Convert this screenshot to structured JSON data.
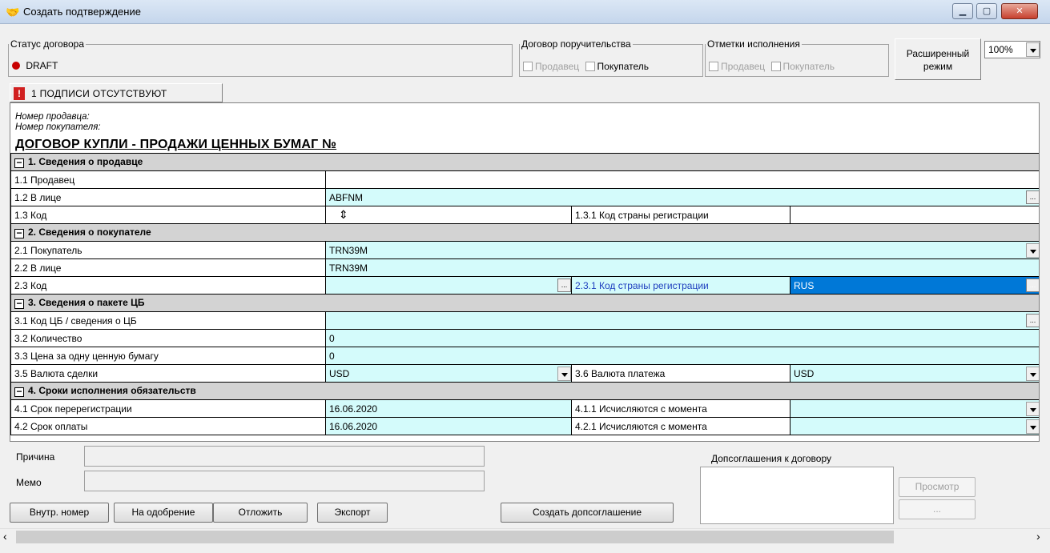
{
  "window": {
    "title": "Создать подтверждение",
    "icon": "handshake-icon"
  },
  "status": {
    "legend": "Статус договора",
    "value": "DRAFT",
    "color": "#c80000"
  },
  "guarantee": {
    "legend": "Договор поручительства",
    "seller": "Продавец",
    "buyer": "Покупатель"
  },
  "execution": {
    "legend": "Отметки исполнения",
    "seller": "Продавец",
    "buyer": "Покупатель"
  },
  "extended_mode": "Расширенный режим",
  "zoom": "100%",
  "signature_tab": "1 ПОДПИСИ ОТСУТСТВУЮТ",
  "doc": {
    "seller_no": "Номер продавца:",
    "buyer_no": "Номер покупателя:",
    "title": "ДОГОВОР КУПЛИ - ПРОДАЖИ ЦЕННЫХ БУМАГ №",
    "s1": "1. Сведения о продавце",
    "r1_1": "1.1 Продавец",
    "r1_2": "1.2 В лице",
    "r1_2v": "ABFNM",
    "r1_3": "1.3 Код",
    "r1_3_1": "1.3.1 Код страны регистрации",
    "s2": "2. Сведения о покупателе",
    "r2_1": "2.1 Покупатель",
    "r2_1v": "TRN39M",
    "r2_2": "2.2 В лице",
    "r2_2v": "TRN39M",
    "r2_3": "2.3 Код",
    "r2_3_1": "2.3.1 Код страны регистрации",
    "r2_3_1v": "RUS",
    "s3": "3. Сведения о пакете ЦБ",
    "r3_1": "3.1 Код ЦБ / сведения о ЦБ",
    "r3_2": "3.2 Количество",
    "r3_2v": "0",
    "r3_3": "3.3 Цена за одну ценную бумагу",
    "r3_3v": "0",
    "r3_5": "3.5 Валюта сделки",
    "r3_5v": "USD",
    "r3_6": "3.6 Валюта платежа",
    "r3_6v": "USD",
    "s4": "4. Сроки исполнения обязательств",
    "r4_1": "4.1 Срок перерегистрации",
    "r4_1v": "16.06.2020",
    "r4_1_1": "4.1.1 Исчисляются с момента",
    "r4_2": "4.2 Срок оплаты",
    "r4_2v": "16.06.2020",
    "r4_2_1": "4.2.1 Исчисляются с момента"
  },
  "bottom": {
    "reason": "Причина",
    "memo": "Мемо",
    "supp_label": "Допсоглашения к договору",
    "view": "Просмотр",
    "ellipsis": "...",
    "btn_internal": "Внутр. номер",
    "btn_approve": "На одобрение",
    "btn_postpone": "Отложить",
    "btn_export": "Экспорт",
    "btn_create_supp": "Создать допсоглашение"
  }
}
